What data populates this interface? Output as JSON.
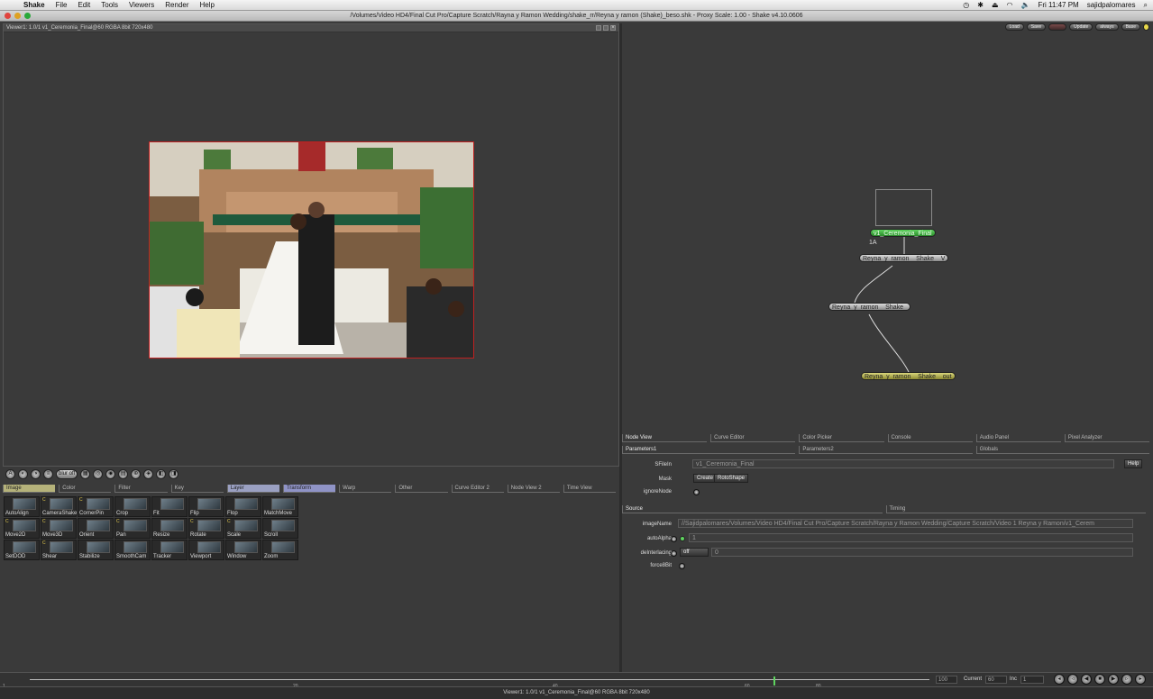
{
  "menubar": {
    "app_name": "Shake",
    "items": [
      "File",
      "Edit",
      "Tools",
      "Viewers",
      "Render",
      "Help"
    ],
    "clock": "Fri 11:47 PM",
    "user": "sajidpalomares"
  },
  "window": {
    "title": "/Volumes/Video HD4/Final Cut Pro/Capture Scratch/Rayna y Ramon Wedding/shake_rr/Reyna y ramon (Shake)_beso.shk - Proxy Scale: 1.00 - Shake v4.10.0606"
  },
  "viewer": {
    "header_label": "Viewer1: 1.0/1 v1_Ceremonia_Final@60 RGBA 8bit 720x480"
  },
  "viewer_toolbar": {
    "buttons": [
      "A",
      "◐",
      "◑",
      "≡",
      "blur off",
      "▦",
      "◎",
      "◉",
      "▤",
      "⊕",
      "◈",
      "◧",
      "◨"
    ]
  },
  "tool_tabs": [
    "Image",
    "Color",
    "Filter",
    "Key",
    "Layer",
    "Transform",
    "Warp",
    "Other",
    "Curve Editor 2",
    "Node View 2",
    "Time View"
  ],
  "tools": [
    {
      "label": "AutoAlign",
      "c": false
    },
    {
      "label": "CameraShake",
      "c": true
    },
    {
      "label": "CornerPin",
      "c": true
    },
    {
      "label": "Crop",
      "c": false
    },
    {
      "label": "Fit",
      "c": false
    },
    {
      "label": "Flip",
      "c": false
    },
    {
      "label": "Flop",
      "c": false
    },
    {
      "label": "MatchMove",
      "c": false
    },
    {
      "label": "Move2D",
      "c": true
    },
    {
      "label": "Move3D",
      "c": true
    },
    {
      "label": "Orient",
      "c": false
    },
    {
      "label": "Pan",
      "c": true
    },
    {
      "label": "Resize",
      "c": false
    },
    {
      "label": "Rotate",
      "c": true
    },
    {
      "label": "Scale",
      "c": true
    },
    {
      "label": "Scroll",
      "c": false
    },
    {
      "label": "SetDOD",
      "c": false
    },
    {
      "label": "Shear",
      "c": true
    },
    {
      "label": "Stabilize",
      "c": false
    },
    {
      "label": "SmoothCam",
      "c": false
    },
    {
      "label": "Tracker",
      "c": false
    },
    {
      "label": "Viewport",
      "c": false
    },
    {
      "label": "Window",
      "c": false
    },
    {
      "label": "Zoom",
      "c": false
    }
  ],
  "node_toolbar": [
    "Load",
    "Save",
    "Update",
    "always",
    "Base"
  ],
  "nodes": {
    "read": "v1_Ceremonia_Final",
    "read_sub": "1A",
    "op1": "Reyna_y_ramon__Shake__V",
    "op2": "Reyna_y_ramon__Shake_",
    "out": "Reyna_y_ramon__Shake__out"
  },
  "panel_tabs_top": [
    "Node View",
    "Curve Editor",
    "Color Picker",
    "Console",
    "Audio Panel",
    "Pixel Analyzer"
  ],
  "panel_tabs_params": [
    "Parameters1",
    "Parameters2",
    "Globals"
  ],
  "params": {
    "filein_label": "SFileIn",
    "filein_value": "v1_Ceremonia_Final",
    "help": "Help",
    "mask_label": "Mask",
    "mask_create": "Create",
    "mask_shape": "RotoShape",
    "ignore_label": "ignoreNode",
    "source_tabs": [
      "Source",
      "Timing"
    ],
    "imagename_label": "imageName",
    "imagename_value": "//Sajidpalomares/Volumes/Video HD4/Final Cut Pro/Capture Scratch/Rayna y Ramon Wedding/Capture Scratch/Video 1 Reyna y Ramon/v1_Cerem",
    "autoalpha_label": "autoAlpha",
    "autoalpha_value": "1",
    "deint_label": "deInterlacing",
    "deint_option": "off",
    "deint_value": "0",
    "force8_label": "force8Bit"
  },
  "timebar": {
    "ticks": [
      "1",
      "20",
      "40",
      "60",
      "80"
    ],
    "end_value": "100",
    "current_label": "Current",
    "current_value": "60",
    "inc_label": "Inc",
    "inc_value": "1"
  },
  "status": "Viewer1: 1.0/1 v1_Ceremonia_Final@60 RGBA 8bit 720x480",
  "colors": {
    "accent_green": "#5fd45f",
    "frame_border": "#c02020",
    "output_node": "#d9d67b"
  }
}
